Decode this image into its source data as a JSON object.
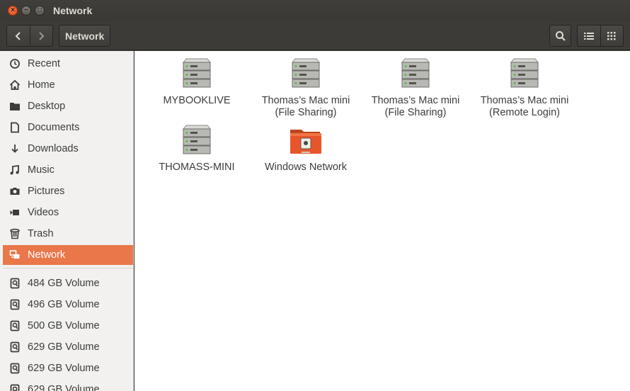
{
  "window": {
    "title": "Network"
  },
  "toolbar": {
    "back_icon": "chevron-left-icon",
    "forward_icon": "chevron-right-icon",
    "breadcrumb": "Network",
    "search_icon": "search-icon",
    "list_view_icon": "list-view-icon",
    "grid_view_icon": "grid-view-icon"
  },
  "sidebar": {
    "places": [
      {
        "label": "Recent",
        "icon": "clock-icon"
      },
      {
        "label": "Home",
        "icon": "home-icon"
      },
      {
        "label": "Desktop",
        "icon": "folder-icon"
      },
      {
        "label": "Documents",
        "icon": "document-icon"
      },
      {
        "label": "Downloads",
        "icon": "download-icon"
      },
      {
        "label": "Music",
        "icon": "music-icon"
      },
      {
        "label": "Pictures",
        "icon": "camera-icon"
      },
      {
        "label": "Videos",
        "icon": "video-icon"
      },
      {
        "label": "Trash",
        "icon": "trash-icon"
      },
      {
        "label": "Network",
        "icon": "network-icon",
        "active": true
      }
    ],
    "volumes": [
      {
        "label": "484 GB Volume",
        "icon": "drive-icon"
      },
      {
        "label": "496 GB Volume",
        "icon": "drive-icon"
      },
      {
        "label": "500 GB Volume",
        "icon": "drive-icon"
      },
      {
        "label": "629 GB Volume",
        "icon": "drive-icon"
      },
      {
        "label": "629 GB Volume",
        "icon": "drive-icon"
      },
      {
        "label": "629 GB Volume",
        "icon": "drive-icon"
      }
    ]
  },
  "items": [
    {
      "line1": "MYBOOKLIVE",
      "line2": "",
      "icon": "server-icon"
    },
    {
      "line1": "Thomas’s Mac mini",
      "line2": "(File Sharing)",
      "icon": "server-icon"
    },
    {
      "line1": "Thomas’s Mac mini",
      "line2": "(File Sharing)",
      "icon": "server-icon"
    },
    {
      "line1": "Thomas’s Mac mini",
      "line2": "(Remote Login)",
      "icon": "server-icon"
    },
    {
      "line1": "THOMASS-MINI",
      "line2": "",
      "icon": "server-icon"
    },
    {
      "line1": "Windows Network",
      "line2": "",
      "icon": "network-folder-icon"
    }
  ],
  "colors": {
    "accent": "#e9774a",
    "titlebar": "#3c3b37",
    "sidebar_bg": "#f2f1f0"
  }
}
